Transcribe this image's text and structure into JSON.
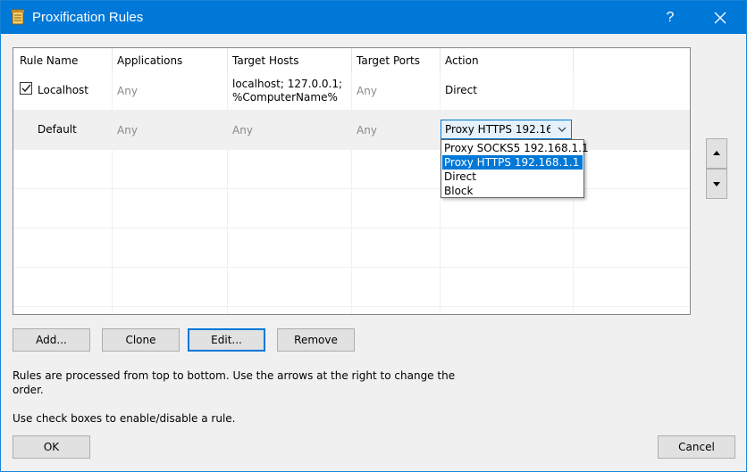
{
  "window": {
    "title": "Proxification Rules",
    "help_label": "?",
    "close_label": "✕"
  },
  "columns": [
    "Rule Name",
    "Applications",
    "Target Hosts",
    "Target Ports",
    "Action"
  ],
  "rules": [
    {
      "checked": true,
      "name": "Localhost",
      "applications": "Any",
      "hosts_line1": "localhost; 127.0.0.1;",
      "hosts_line2": "%ComputerName%",
      "ports": "Any",
      "action": "Direct"
    },
    {
      "name": "Default",
      "applications": "Any",
      "hosts": "Any",
      "ports": "Any",
      "action": "Proxy HTTPS 192.168.1.1"
    }
  ],
  "action_dropdown": {
    "options": [
      "Proxy SOCKS5 192.168.1.1",
      "Proxy HTTPS 192.168.1.1",
      "Direct",
      "Block"
    ],
    "selected_index": 1
  },
  "buttons": {
    "add": "Add...",
    "clone": "Clone",
    "edit": "Edit...",
    "remove": "Remove",
    "ok": "OK",
    "cancel": "Cancel"
  },
  "info": {
    "line1": "Rules are processed from top to bottom. Use the arrows at the right to change the",
    "line2": "order.",
    "line3": "Use check boxes to enable/disable a rule."
  },
  "colors": {
    "titlebar": "#0078d7",
    "selection": "#0078d7",
    "button_face": "#e1e1e1"
  }
}
